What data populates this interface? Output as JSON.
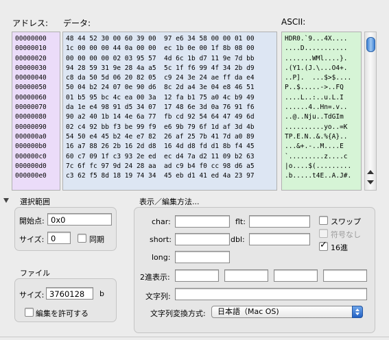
{
  "headers": {
    "address": "アドレス:",
    "data": "データ:",
    "ascii": "ASCII:"
  },
  "addresses": [
    "00000000",
    "00000010",
    "00000020",
    "00000030",
    "00000040",
    "00000050",
    "00000060",
    "00000070",
    "00000080",
    "00000090",
    "000000a0",
    "000000b0",
    "000000c0",
    "000000d0",
    "000000e0"
  ],
  "hex_rows": [
    "48 44 52 30 00 60 39 00  97 e6 34 58 00 00 01 00",
    "1c 00 00 00 44 0a 00 00  ec 1b 0e 00 1f 8b 08 00",
    "00 00 00 00 02 03 95 57  4d 6c 1b d7 11 9e 7d bb",
    "94 28 59 31 9e 28 4a a5  5c 1f f6 99 4f 34 2b d9",
    "c8 da 50 5d 06 20 82 05  c9 24 3e 24 ae ff da e4",
    "50 04 b2 24 07 0e 90 d6  8c 2d a4 3e 04 e8 46 51",
    "01 b5 95 bc 4c ea 00 3a  12 fa b1 75 a0 4c b9 49",
    "da 1e e4 98 91 d5 34 07  17 48 6e 3d 0a 76 91 f6",
    "90 a2 40 1b 14 4e 6a 77  fb cd 92 54 64 47 49 6d",
    "02 c4 92 bb f3 be 99 f9  e6 9b 79 6f 1d af 3d 4b",
    "54 50 e4 45 b2 4e e7 82  26 af 25 7b 41 7d a0 89",
    "16 a7 88 26 2b 16 2d d8  16 4d d8 fd d1 8b f4 45",
    "60 c7 09 1f c3 93 2e ed  ec d4 7a d2 11 09 b2 63",
    "7c 6f fc 97 9d 24 28 aa  ad c9 b4 f0 cc 98 d6 a5",
    "c3 62 f5 8d 18 19 74 34  45 eb d1 41 ed 4a 23 97"
  ],
  "ascii_rows": [
    "HDR0.`9...4X....",
    "....D...........",
    ".......WMl....}.",
    ".(Y1.(J.\\...O4+.",
    "..P].  ...$>$....",
    "P..$.....->..FQ",
    "....L..:..u.L.I",
    "......4..Hn=.v..",
    "..@..Nju..TdGIm",
    "..........yo..=K",
    "TP.E.N..&.%{A}..",
    "...&+.-..M....E",
    "`.........z....c",
    "|o....$(.........",
    ".b.....t4E..A.J#."
  ],
  "selection": {
    "title": "選択範囲",
    "start_label": "開始点:",
    "start_value": "0x0",
    "size_label": "サイズ:",
    "size_value": "0",
    "sync_label": "同期"
  },
  "display": {
    "title": "表示／編集方法...",
    "char_label": "char:",
    "flt_label": "flt:",
    "short_label": "short:",
    "dbl_label": "dbl:",
    "long_label": "long:",
    "swap_label": "スワップ",
    "unsigned_label": "符号なし",
    "hex16_label": "16進",
    "binary_label": "2進表示:",
    "string_label": "文字列:",
    "conversion_label": "文字列変換方式:",
    "conversion_value": "日本語（Mac OS)"
  },
  "file": {
    "title": "ファイル",
    "size_label": "サイズ:",
    "size_value": "3760128",
    "size_unit": "b",
    "edit_label": "編集を許可する"
  },
  "checkbox_states": {
    "sync": false,
    "swap": false,
    "unsigned": false,
    "hex16": true,
    "allow_edit": false
  }
}
